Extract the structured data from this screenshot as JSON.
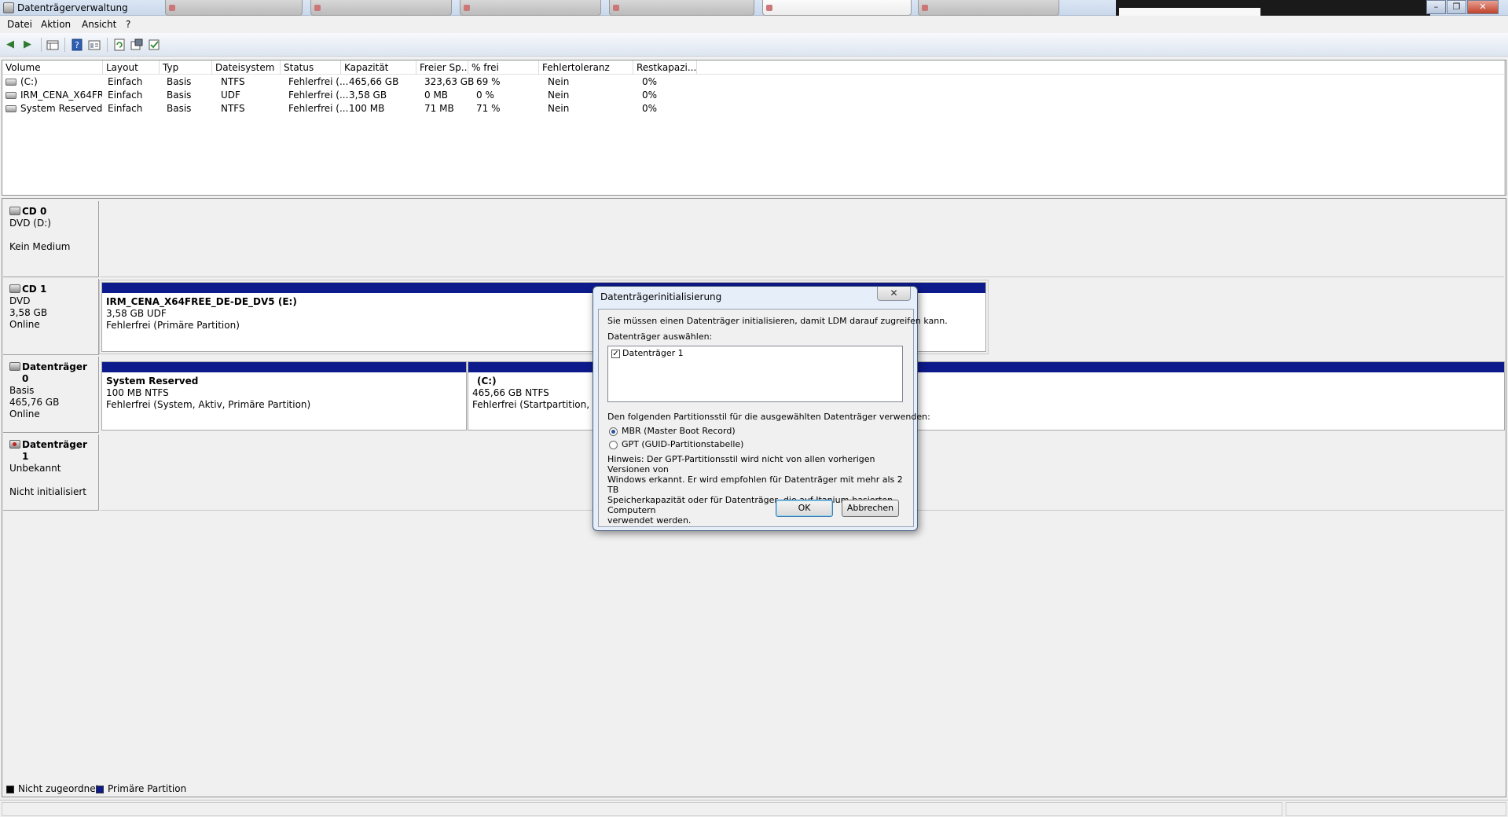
{
  "window": {
    "title": "Datenträgerverwaltung",
    "controls": [
      "–",
      "❐",
      "✕"
    ]
  },
  "menu": [
    "Datei",
    "Aktion",
    "Ansicht",
    "?"
  ],
  "toolbar_icons": [
    "back-icon",
    "forward-icon",
    "console-tree-icon",
    "help-icon",
    "properties-icon",
    "refresh-icon",
    "settings-icon",
    "check-icon"
  ],
  "volume_list": {
    "columns": [
      "Volume",
      "Layout",
      "Typ",
      "Dateisystem",
      "Status",
      "Kapazität",
      "Freier Sp...",
      "% frei",
      "Fehlertoleranz",
      "Restkapazi..."
    ],
    "rows": [
      [
        "(C:)",
        "Einfach",
        "Basis",
        "NTFS",
        "Fehlerfrei (...",
        "465,66 GB",
        "323,63 GB",
        "69 %",
        "Nein",
        "0%"
      ],
      [
        "IRM_CENA_X64FR...",
        "Einfach",
        "Basis",
        "UDF",
        "Fehlerfrei (...",
        "3,58 GB",
        "0 MB",
        "0 %",
        "Nein",
        "0%"
      ],
      [
        "System Reserved",
        "Einfach",
        "Basis",
        "NTFS",
        "Fehlerfrei (...",
        "100 MB",
        "71 MB",
        "71 %",
        "Nein",
        "0%"
      ]
    ]
  },
  "disks": [
    {
      "name": "CD 0",
      "line1": "DVD (D:)",
      "line2": "",
      "line3": "Kein Medium"
    },
    {
      "name": "CD 1",
      "line1": "DVD",
      "line2": "3,58 GB",
      "line3": "Online"
    },
    {
      "name": "Datenträger 0",
      "line1": "Basis",
      "line2": "465,76 GB",
      "line3": "Online"
    },
    {
      "name": "Datenträger 1",
      "line1": "Unbekannt",
      "line2": "",
      "line3": "Nicht initialisiert"
    }
  ],
  "partitions": {
    "cd1": {
      "title": "IRM_CENA_X64FREE_DE-DE_DV5  (E:)",
      "size": "3,58 GB UDF",
      "status": "Fehlerfrei (Primäre Partition)"
    },
    "reserved": {
      "title": "System Reserved",
      "size": "100 MB NTFS",
      "status": "Fehlerfrei (System, Aktiv, Primäre Partition)"
    },
    "c": {
      "title": "(C:)",
      "size": "465,66 GB NTFS",
      "status": "Fehlerfrei (Startpartition, Ausl"
    }
  },
  "legend": {
    "items": [
      {
        "label": "Nicht zugeordnet",
        "color": "#000000"
      },
      {
        "label": "Primäre Partition",
        "color": "#0d1a8c"
      }
    ]
  },
  "dialog": {
    "title": "Datenträgerinitialisierung",
    "close": "✕",
    "intro": "Sie müssen einen Datenträger initialisieren, damit LDM darauf zugreifen kann.",
    "select_label": "Datenträger auswählen:",
    "disk_item": "Datenträger 1",
    "disk_item_checked": true,
    "style_label": "Den folgenden Partitionsstil für die ausgewählten Datenträger verwenden:",
    "option_mbr": "MBR (Master Boot Record)",
    "option_gpt": "GPT (GUID-Partitionstabelle)",
    "selected_option": "MBR",
    "note": "Hinweis: Der GPT-Partitionsstil wird nicht von allen vorherigen Versionen von\nWindows erkannt. Er wird empfohlen für Datenträger mit mehr als 2 TB\nSpeicherkapazität oder für Datenträger, die auf Itanium-basierten Computern\nverwendet werden.",
    "ok": "OK",
    "cancel": "Abbrechen"
  },
  "colors": {
    "primary_partition": "#0d1a8c",
    "unallocated": "#000000",
    "dialog_frame": "#e6eef9"
  }
}
